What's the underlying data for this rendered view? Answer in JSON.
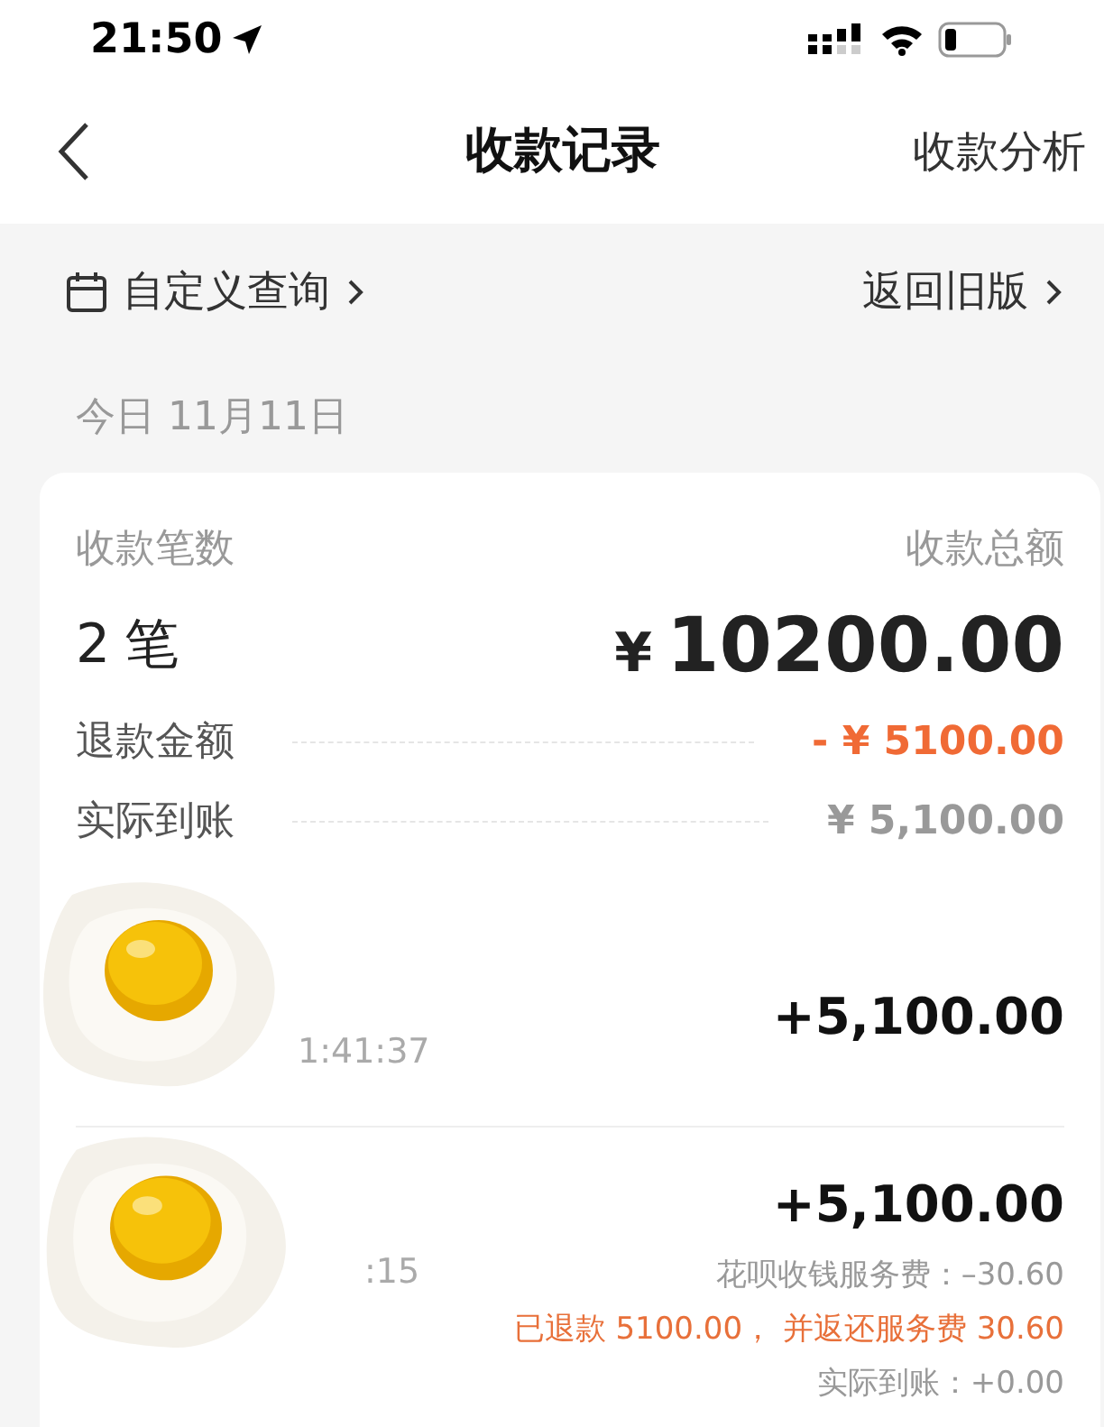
{
  "status_bar": {
    "time": "21:50"
  },
  "nav": {
    "title": "收款记录",
    "action": "收款分析"
  },
  "filter": {
    "query": "自定义查询",
    "old_version": "返回旧版"
  },
  "date": "今日 11月11日",
  "summary": {
    "count_label": "收款笔数",
    "count": "2",
    "count_unit": "笔",
    "total_label": "收款总额",
    "currency": "¥",
    "total": "10200.00",
    "lines": [
      {
        "label": "退款金额",
        "value": "- ¥ 5100.00",
        "kind": "refund"
      },
      {
        "label": "实际到账",
        "value": "¥ 5,100.00",
        "kind": "net"
      }
    ]
  },
  "transactions": [
    {
      "time": "1:41:37",
      "amount": "+5,100.00"
    },
    {
      "time": ":15",
      "amount": "+5,100.00",
      "notes": [
        {
          "text": "花呗收钱服务费：–30.60",
          "kind": "fee"
        },
        {
          "text": "已退款 5100.00， 并返还服务费 30.60",
          "kind": "refund"
        },
        {
          "text": "实际到账：+0.00",
          "kind": "fee"
        }
      ]
    }
  ]
}
